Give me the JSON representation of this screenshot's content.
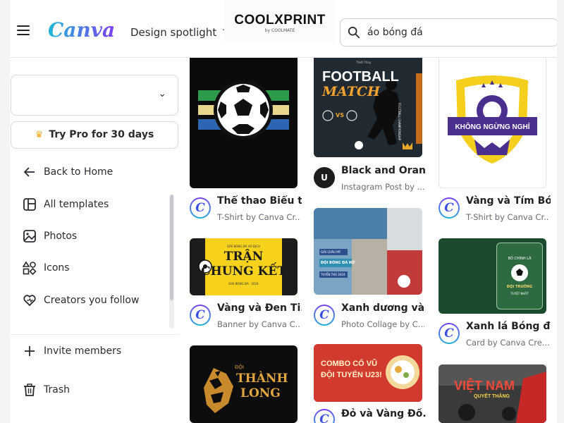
{
  "header": {
    "logo": "Canva",
    "spotlight_label": "Design spotlight",
    "brand_name": "COOLXPRINT",
    "brand_sub": "by COOLMATE",
    "search_value": "áo bóng đá"
  },
  "sidebar": {
    "try_pro_label": "Try Pro for 30 days",
    "nav": [
      {
        "label": "Back to Home",
        "icon": "arrow-left-icon"
      },
      {
        "label": "All templates",
        "icon": "templates-icon"
      },
      {
        "label": "Photos",
        "icon": "image-icon"
      },
      {
        "label": "Icons",
        "icon": "shapes-icon"
      },
      {
        "label": "Creators you follow",
        "icon": "heart-icon"
      },
      {
        "label": "Invite members",
        "icon": "plus-icon"
      },
      {
        "label": "Trash",
        "icon": "trash-icon"
      }
    ]
  },
  "templates": {
    "col1": [
      {
        "title": "Thể thao Biểu t...",
        "subtitle": "T-Shirt by Canva Cr...",
        "avatar": "C"
      },
      {
        "title": "Vàng và Đen Ti...",
        "subtitle": "Banner by Canva C...",
        "avatar": "C",
        "thumb_text": {
          "header": "GIẢI BÓNG ĐÁ VÔ ĐỊCH",
          "line1": "TRẬN",
          "line2": "CHUNG KẾT",
          "footer": "GIẢI BÓNG ĐÁ · 2024"
        }
      },
      {
        "title": "",
        "subtitle": "",
        "avatar": "",
        "thumb_text": {
          "small": "ĐỘI",
          "line1": "THÀNH",
          "line2": "LONG"
        }
      }
    ],
    "col2": [
      {
        "title": "Black and Oran...",
        "subtitle": "Instagram Post by ...",
        "avatar": "U",
        "thumb_text": {
          "tag": "Thiết Thủy",
          "line1": "FOOTBALL",
          "line2": "MATCH",
          "vs": "VS",
          "side": "FOOTBALL CHAMPIONSHIP"
        }
      },
      {
        "title": "Xanh dương và ...",
        "subtitle": "Photo Collage by C...",
        "avatar": "C",
        "thumb_text": {
          "line1": "GIẢI CHÂU MỸ",
          "line2": "ĐỘI BÓNG ĐÁ NỮ",
          "line3": "TUYỂN THỦ 2024"
        }
      },
      {
        "title": "Đỏ và Vàng Đồ...",
        "subtitle": "",
        "avatar": "C",
        "thumb_text": {
          "line1": "COMBO CỔ VŨ",
          "line2": "ĐỘI TUYỂN U23!"
        }
      }
    ],
    "col3": [
      {
        "title": "Vàng và Tím Bó...",
        "subtitle": "T-Shirt by Canva Cr...",
        "avatar": "C",
        "thumb_text": {
          "banner": "KHÔNG NGỪNG NGHỈ"
        }
      },
      {
        "title": "Xanh lá Bóng đ...",
        "subtitle": "Card by Canva Cre...",
        "avatar": "C",
        "thumb_text": {
          "line1": "BỐ CHÍNH LÀ",
          "line2": "ĐỘI TRƯỞNG",
          "line3": "TUYỆT NHẤT"
        }
      },
      {
        "title": "",
        "subtitle": "",
        "avatar": "",
        "thumb_text": {
          "line1": "VIỆT NAM",
          "line2": "QUYẾT THẮNG"
        }
      }
    ]
  },
  "colors": {
    "canva_teal": "#1fb8d6",
    "canva_purple": "#7d3ef0",
    "crown": "#f0a820"
  }
}
